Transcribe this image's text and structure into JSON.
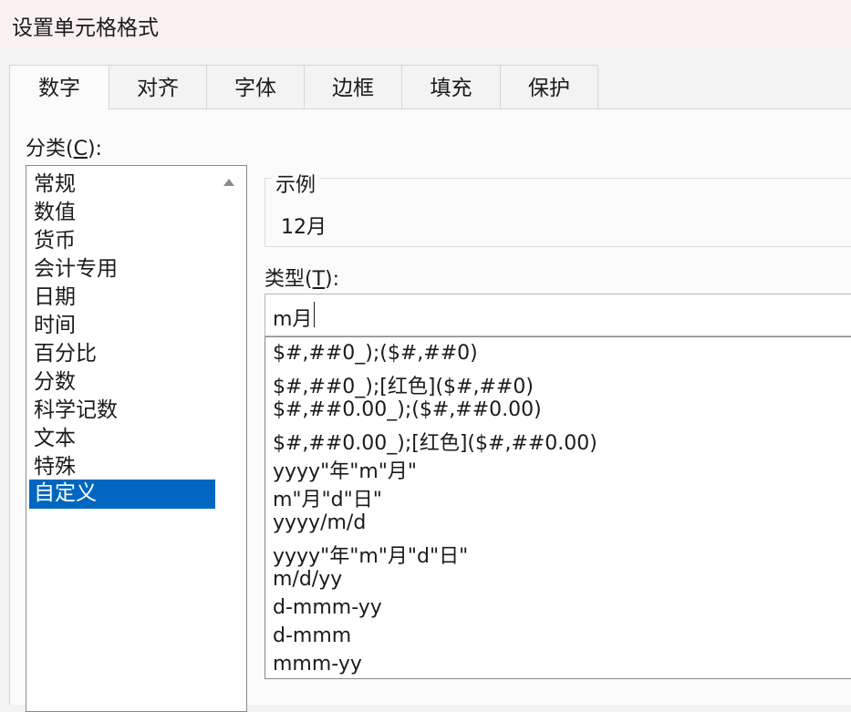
{
  "window": {
    "title": "设置单元格格式"
  },
  "tabs": [
    {
      "label": "数字",
      "active": true
    },
    {
      "label": "对齐",
      "active": false
    },
    {
      "label": "字体",
      "active": false
    },
    {
      "label": "边框",
      "active": false
    },
    {
      "label": "填充",
      "active": false
    },
    {
      "label": "保护",
      "active": false
    }
  ],
  "category": {
    "label_text": "分类(",
    "label_key": "C",
    "label_end": "):",
    "items": [
      "常规",
      "数值",
      "货币",
      "会计专用",
      "日期",
      "时间",
      "百分比",
      "分数",
      "科学记数",
      "文本",
      "特殊",
      "自定义"
    ],
    "selected": "自定义"
  },
  "sample": {
    "legend": "示例",
    "value": "12月"
  },
  "type": {
    "label_text": "类型(",
    "label_key": "T",
    "label_end": "):",
    "input_value": "m月",
    "formats": [
      "$#,##0_);($#,##0)",
      "$#,##0_);[红色]($#,##0)",
      "$#,##0.00_);($#,##0.00)",
      "$#,##0.00_);[红色]($#,##0.00)",
      "yyyy\"年\"m\"月\"",
      "m\"月\"d\"日\"",
      "yyyy/m/d",
      "yyyy\"年\"m\"月\"d\"日\"",
      "m/d/yy",
      "d-mmm-yy",
      "d-mmm",
      "mmm-yy"
    ]
  },
  "colors": {
    "selection": "#0067c0",
    "titlebar": "#f9f1f1",
    "panel": "#fbfbfb"
  }
}
